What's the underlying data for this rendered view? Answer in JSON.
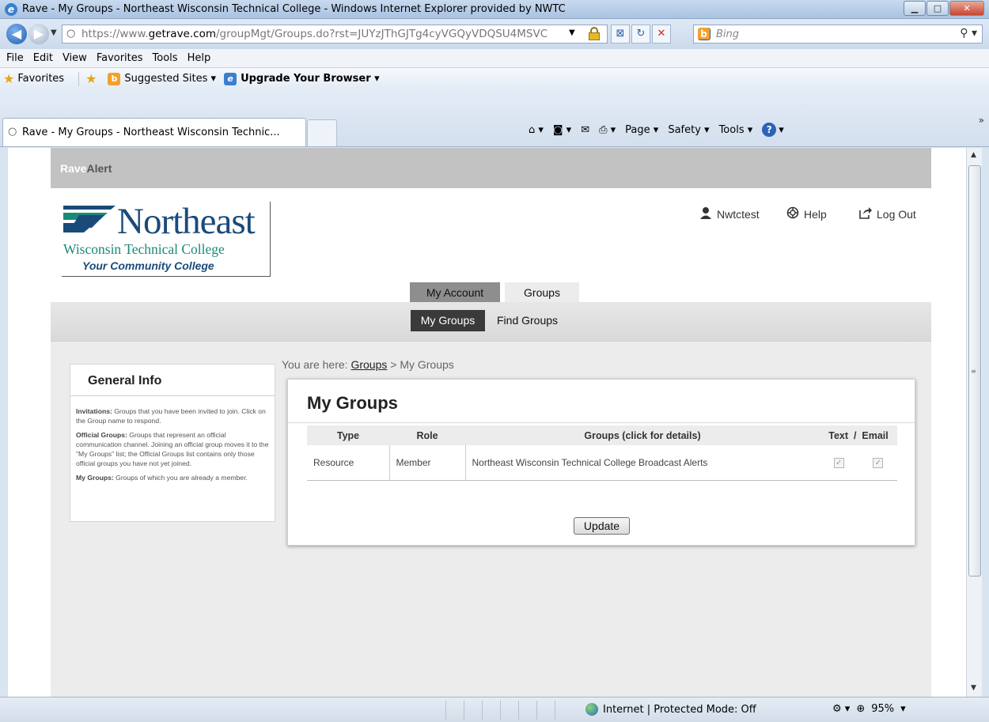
{
  "window": {
    "title": "Rave - My Groups - Northeast Wisconsin Technical College - Windows Internet Explorer provided by NWTC",
    "minimize": "▁",
    "maximize": "□",
    "close": "✕"
  },
  "address": {
    "url_prefix": "https://www.",
    "url_domain": "getrave.com",
    "url_path": "/groupMgt/Groups.do?rst=JUYzJThGJTg4cyVGQyVDQSU4MSVC",
    "search_placeholder": "Bing"
  },
  "menu": [
    "File",
    "Edit",
    "View",
    "Favorites",
    "Tools",
    "Help"
  ],
  "favorites": {
    "favorites_label": "Favorites",
    "suggested_label": "Suggested Sites ▾",
    "upgrade_label": "Upgrade Your Browser ▾"
  },
  "tab": {
    "label": "Rave - My Groups - Northeast Wisconsin Technic..."
  },
  "commandbar": {
    "page": "Page ▾",
    "safety": "Safety ▾",
    "tools": "Tools ▾"
  },
  "site": {
    "brand_rave": "Rave",
    "brand_alert": "Alert",
    "logo": {
      "name": "Northeast",
      "subtitle": "Wisconsin Technical College",
      "tagline": "Your Community College"
    },
    "user_nav": {
      "user": "Nwtctest",
      "help": "Help",
      "logout": "Log Out"
    },
    "main_tabs": {
      "my_account": "My Account",
      "groups": "Groups"
    },
    "sub_tabs": {
      "my_groups": "My Groups",
      "find_groups": "Find Groups"
    }
  },
  "general_info": {
    "title": "General Info",
    "invitations_label": "Invitations:",
    "invitations_text": " Groups that you have been invited to join. Click on the Group name to respond.",
    "official_label": "Official Groups:",
    "official_text": " Groups that represent an official communication channel. Joining an official group moves it to the \"My Groups\" list; the Official Groups list contains only those official groups you have not yet joined.",
    "mygroups_label": "My Groups:",
    "mygroups_text": " Groups of which you are already a member."
  },
  "breadcrumb": {
    "prefix": "You are here: ",
    "link": "Groups",
    "current": " > My Groups"
  },
  "panel": {
    "title": "My Groups",
    "columns": {
      "type": "Type",
      "role": "Role",
      "groups": "Groups (click for details)",
      "text_email": "Text  /  Email"
    },
    "rows": [
      {
        "type": "Resource",
        "role": "Member",
        "group": "Northeast Wisconsin Technical College Broadcast Alerts",
        "text_checked": "✓",
        "email_checked": "✓"
      }
    ],
    "update_label": "Update"
  },
  "status": {
    "zone": "Internet | Protected Mode: Off",
    "zoom": "95%"
  },
  "colors": {
    "rave_bar": "#c2c2c2",
    "active_subtab": "#3a3a3a",
    "logo_blue": "#1a4a7a",
    "logo_teal": "#1a8a78"
  }
}
